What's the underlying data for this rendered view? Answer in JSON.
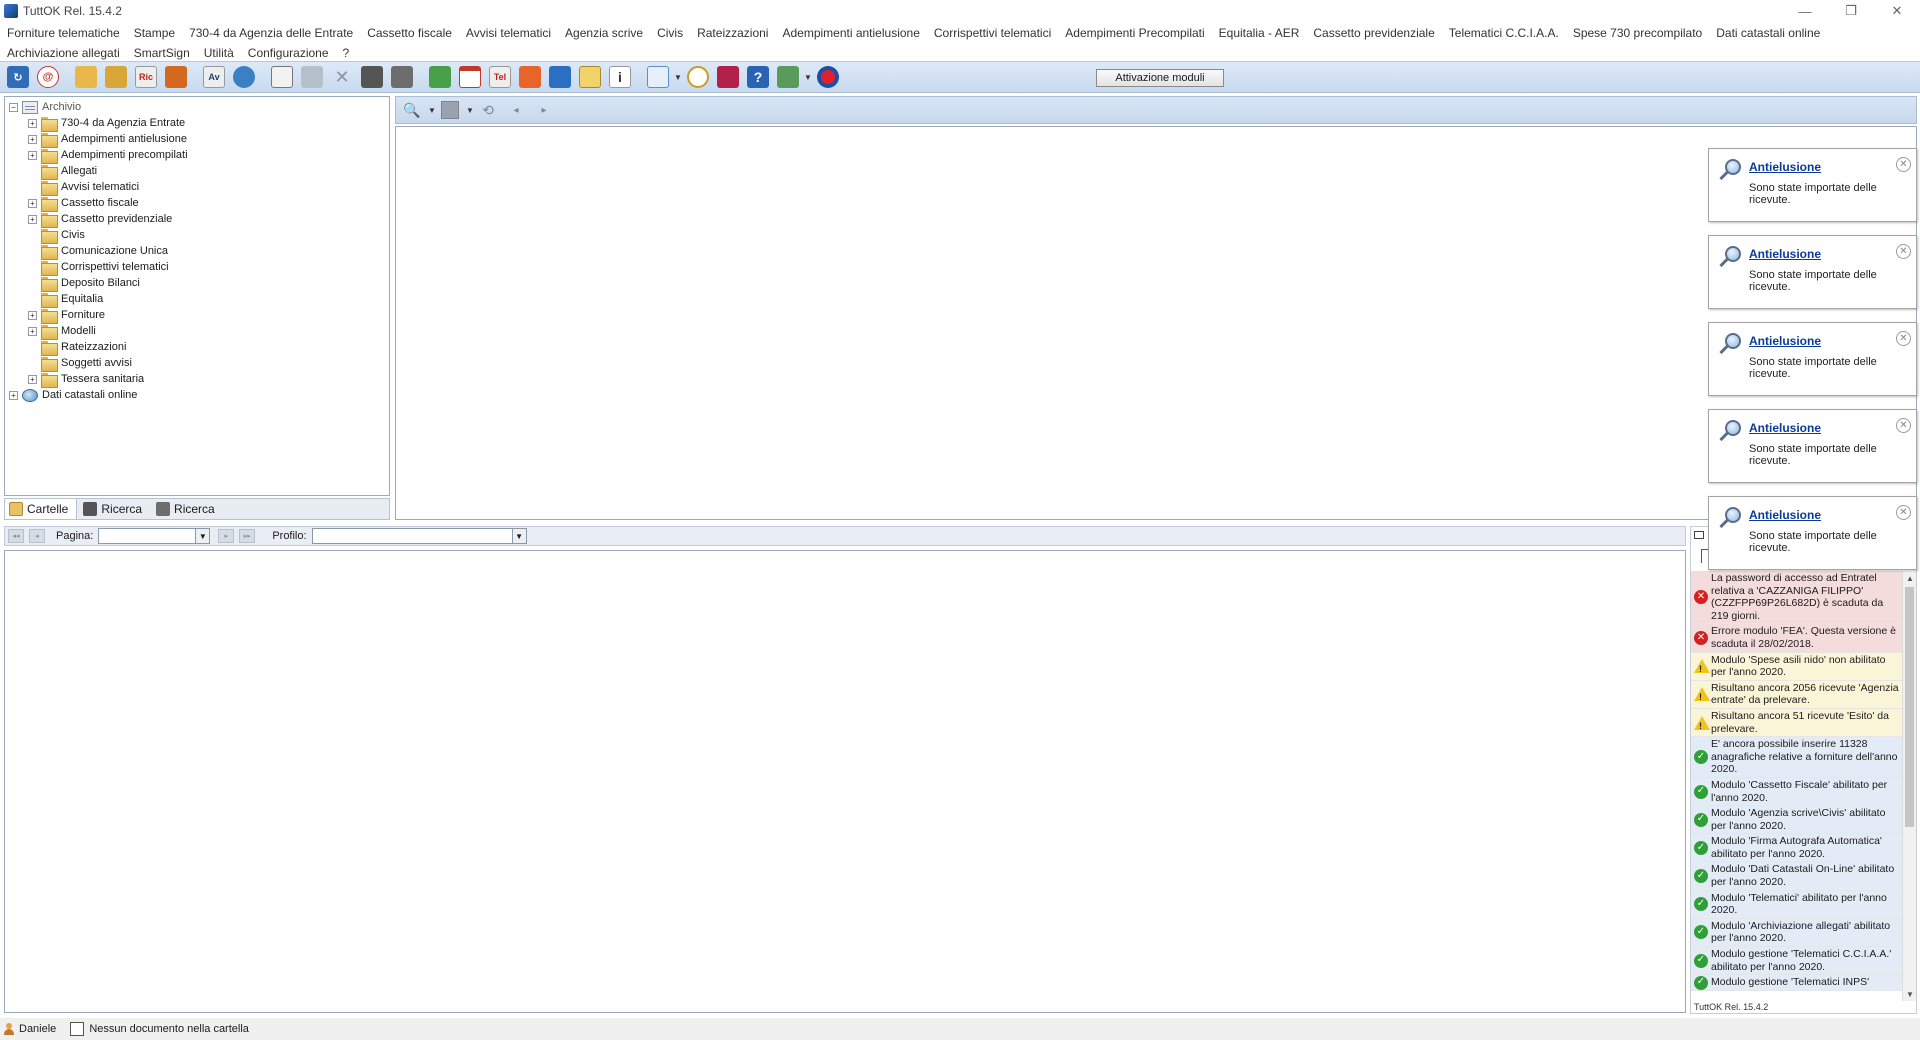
{
  "window": {
    "title": "TuttOK  Rel. 15.4.2",
    "controls": [
      "—",
      "❐",
      "✕"
    ]
  },
  "menu": {
    "row1": [
      "Forniture telematiche",
      "Stampe",
      "730-4 da Agenzia delle Entrate",
      "Cassetto fiscale",
      "Avvisi telematici",
      "Agenzia scrive",
      "Civis",
      "Rateizzazioni",
      "Adempimenti antielusione",
      "Corrispettivi telematici",
      "Adempimenti Precompilati",
      "Equitalia - AER",
      "Cassetto previdenziale",
      "Telematici C.C.I.A.A.",
      "Spese 730 precompilato",
      "Dati catastali online"
    ],
    "row2": [
      "Archiviazione allegati",
      "SmartSign",
      "Utilità",
      "Configurazione",
      "?"
    ]
  },
  "toolbar": {
    "activate_label": "Attivazione moduli"
  },
  "tree": {
    "root": "Archivio",
    "items": [
      {
        "label": "730-4 da Agenzia Entrate",
        "expandable": true
      },
      {
        "label": "Adempimenti antielusione",
        "expandable": true
      },
      {
        "label": "Adempimenti precompilati",
        "expandable": true
      },
      {
        "label": "Allegati",
        "expandable": false
      },
      {
        "label": "Avvisi telematici",
        "expandable": false
      },
      {
        "label": "Cassetto fiscale",
        "expandable": true
      },
      {
        "label": "Cassetto previdenziale",
        "expandable": true
      },
      {
        "label": "Civis",
        "expandable": false
      },
      {
        "label": "Comunicazione Unica",
        "expandable": false
      },
      {
        "label": "Corrispettivi telematici",
        "expandable": false
      },
      {
        "label": "Deposito Bilanci",
        "expandable": false
      },
      {
        "label": "Equitalia",
        "expandable": false
      },
      {
        "label": "Forniture",
        "expandable": true
      },
      {
        "label": "Modelli",
        "expandable": true
      },
      {
        "label": "Rateizzazioni",
        "expandable": false
      },
      {
        "label": "Soggetti avvisi",
        "expandable": false
      },
      {
        "label": "Tessera sanitaria",
        "expandable": true
      }
    ],
    "second_root": "Dati catastali online"
  },
  "left_tabs": [
    "Cartelle",
    "Ricerca",
    "Ricerca"
  ],
  "notifications": [
    {
      "title": "Antielusione",
      "text": "Sono state importate delle ricevute."
    },
    {
      "title": "Antielusione",
      "text": "Sono state importate delle ricevute."
    },
    {
      "title": "Antielusione",
      "text": "Sono state importate delle ricevute."
    },
    {
      "title": "Antielusione",
      "text": "Sono state importate delle ricevute."
    },
    {
      "title": "Antielusione",
      "text": "Sono state importate delle ricevute."
    }
  ],
  "pager": {
    "page_label": "Pagina:",
    "page_value": "",
    "profile_label": "Profilo:",
    "profile_value": ""
  },
  "messages": [
    {
      "type": "error",
      "text": "La password di accesso ad Entratel relativa a 'CAZZANIGA FILIPPO' (CZZFPP69P26L682D) è scaduta da 219 giorni."
    },
    {
      "type": "error",
      "text": "Errore modulo 'FEA'. Questa versione è scaduta il 28/02/2018."
    },
    {
      "type": "warn",
      "text": "Modulo 'Spese asili nido' non abilitato per l'anno 2020."
    },
    {
      "type": "warn",
      "text": "Risultano ancora 2056 ricevute 'Agenzia entrate' da prelevare."
    },
    {
      "type": "warn",
      "text": "Risultano ancora 51 ricevute 'Esito' da prelevare."
    },
    {
      "type": "ok",
      "text": "E' ancora possibile inserire 11328 anagrafiche relative a forniture dell'anno 2020."
    },
    {
      "type": "ok",
      "text": "Modulo 'Cassetto Fiscale' abilitato per l'anno 2020."
    },
    {
      "type": "ok",
      "text": "Modulo 'Agenzia scrive\\Civis' abilitato per l'anno 2020."
    },
    {
      "type": "ok",
      "text": "Modulo 'Firma Autografa Automatica' abilitato per l'anno 2020."
    },
    {
      "type": "ok",
      "text": "Modulo 'Dati Catastali On-Line' abilitato per l'anno 2020."
    },
    {
      "type": "ok",
      "text": "Modulo 'Telematici' abilitato per l'anno 2020."
    },
    {
      "type": "ok",
      "text": "Modulo 'Archiviazione allegati' abilitato per l'anno 2020."
    },
    {
      "type": "ok",
      "text": "Modulo gestione 'Telematici C.C.I.A.A.' abilitato per l'anno 2020."
    },
    {
      "type": "ok",
      "text": "Modulo gestione 'Telematici INPS'"
    }
  ],
  "messages_footer": "TuttOK Rel. 15.4.2",
  "status": {
    "user": "Daniele",
    "doc_status": "Nessun documento nella cartella"
  },
  "colors": {
    "toolbar_bg": "#c8daef",
    "error_bg": "#f5dcdc",
    "warn_bg": "#fbf5d8",
    "ok_bg": "#e3ecf6",
    "link_blue": "#0b3b9a"
  }
}
